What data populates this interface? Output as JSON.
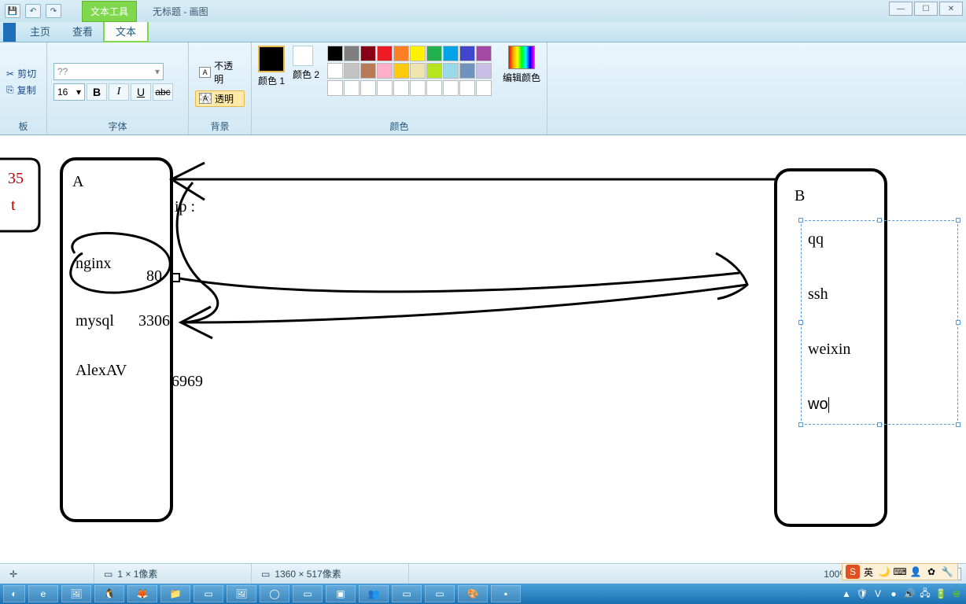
{
  "titlebar": {
    "context_tab": "文本工具",
    "title": "无标题 - 画图"
  },
  "tabs": {
    "home": "主页",
    "view": "查看",
    "text": "文本"
  },
  "clipboard": {
    "cut": "剪切",
    "copy": "复制",
    "group": "板"
  },
  "font": {
    "family_placeholder": "??",
    "size": "16",
    "bold": "B",
    "italic": "I",
    "underline": "U",
    "strike": "abc",
    "group": "字体"
  },
  "background": {
    "opaque": "不透明",
    "transparent": "透明",
    "group": "背景"
  },
  "colors": {
    "color1": "颜色 1",
    "color2": "颜色 2",
    "edit": "编辑颜色",
    "group": "颜色",
    "row1": [
      "#000000",
      "#7f7f7f",
      "#880015",
      "#ed1c24",
      "#ff7f27",
      "#fff200",
      "#22b14c",
      "#00a2e8",
      "#3f48cc",
      "#a349a4"
    ],
    "row2": [
      "#ffffff",
      "#c3c3c3",
      "#b97a57",
      "#ffaec9",
      "#ffc90e",
      "#efe4b0",
      "#b5e61d",
      "#99d9ea",
      "#7092be",
      "#c8bfe7"
    ],
    "row3": [
      "#ffffff",
      "#ffffff",
      "#ffffff",
      "#ffffff",
      "#ffffff",
      "#ffffff",
      "#ffffff",
      "#ffffff",
      "#ffffff",
      "#ffffff"
    ]
  },
  "canvas": {
    "left_frag1": "35",
    "left_frag2": "t",
    "boxA": "A",
    "ip_label": "ip :",
    "nginx": "nginx",
    "port80": "80",
    "mysql": "mysql",
    "port3306": "3306",
    "alexav": "AlexAV",
    "port6969": "6969",
    "boxB": "B",
    "qq": "qq",
    "ssh": "ssh",
    "weixin": "weixin",
    "wo": "wo"
  },
  "status": {
    "cursor": "",
    "selection": "1 × 1像素",
    "size": "1360 × 517像素",
    "zoom": "100%"
  },
  "ime": {
    "s": "S",
    "lang": "英"
  }
}
